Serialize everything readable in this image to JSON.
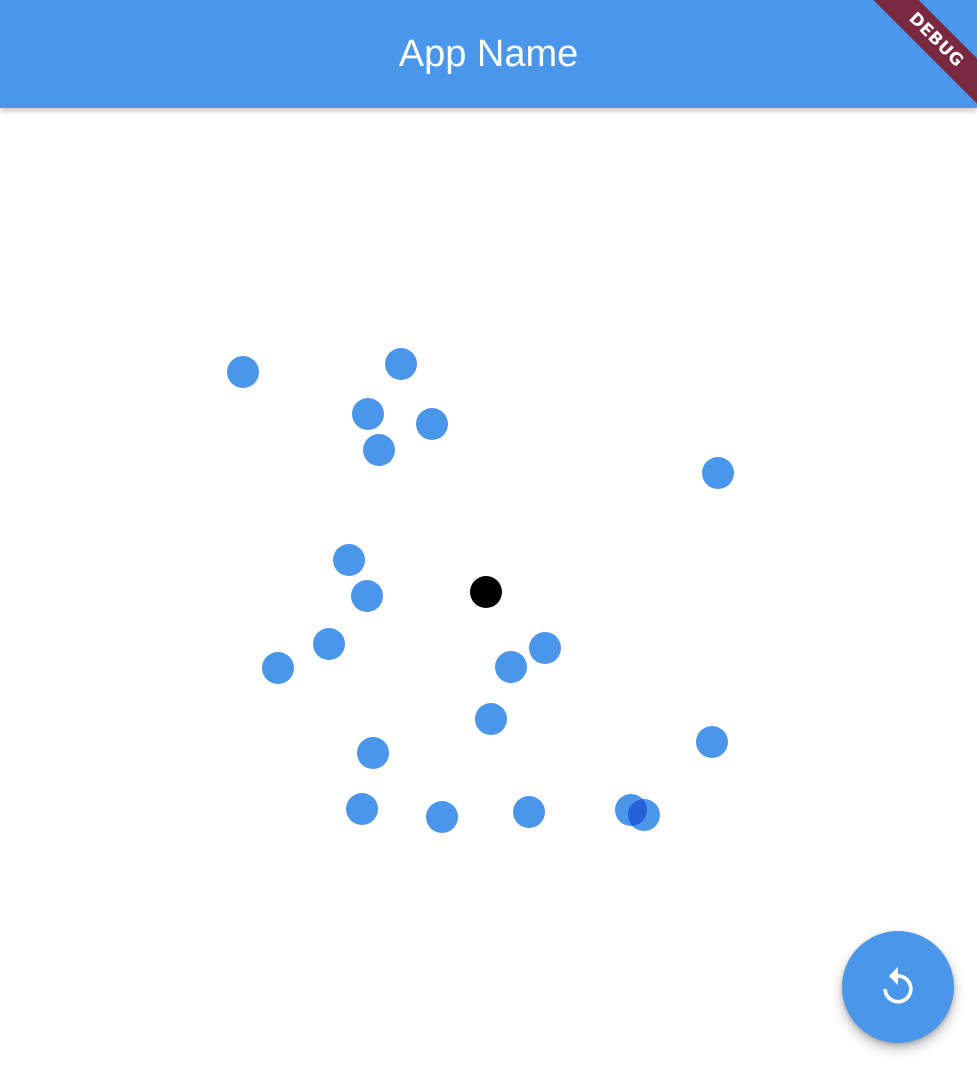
{
  "appbar": {
    "title": "App Name",
    "color": "#4a96eb"
  },
  "debug_banner": {
    "label": "DEBUG",
    "color": "#7a2940"
  },
  "scene": {
    "dot_color": "#4a96eb",
    "overlap_color": "#2461d8",
    "center_color": "#000000",
    "dot_count": 20
  },
  "fab": {
    "icon": "replay-icon",
    "color": "#4a96eb"
  }
}
